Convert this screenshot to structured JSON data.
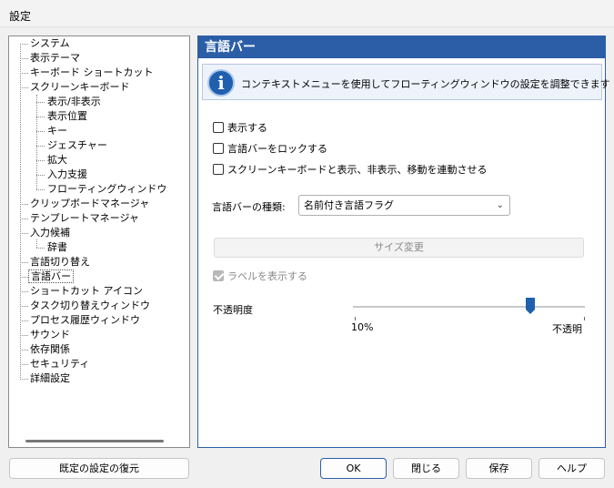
{
  "window": {
    "title": "設定"
  },
  "tree": {
    "items": [
      {
        "label": "システム"
      },
      {
        "label": "表示テーマ"
      },
      {
        "label": "キーボード ショートカット"
      },
      {
        "label": "スクリーンキーボード"
      },
      {
        "label": "表示/非表示"
      },
      {
        "label": "表示位置"
      },
      {
        "label": "キー"
      },
      {
        "label": "ジェスチャー"
      },
      {
        "label": "拡大"
      },
      {
        "label": "入力支援"
      },
      {
        "label": "フローティングウィンドウ"
      },
      {
        "label": "クリップボードマネージャ"
      },
      {
        "label": "テンプレートマネージャ"
      },
      {
        "label": "入力候補"
      },
      {
        "label": "辞書"
      },
      {
        "label": "言語切り替え"
      },
      {
        "label": "言語バー"
      },
      {
        "label": "ショートカット アイコン"
      },
      {
        "label": "タスク切り替えウィンドウ"
      },
      {
        "label": "プロセス履歴ウィンドウ"
      },
      {
        "label": "サウンド"
      },
      {
        "label": "依存関係"
      },
      {
        "label": "セキュリティ"
      },
      {
        "label": "詳細設定"
      }
    ],
    "selected": "言語バー"
  },
  "panel": {
    "title": "言語バー",
    "info_text": "コンテキストメニューを使用してフローティングウィンドウの設定を調整できます",
    "options": {
      "show": {
        "label": "表示する",
        "checked": false
      },
      "lock": {
        "label": "言語バーをロックする",
        "checked": false
      },
      "sync": {
        "label": "スクリーンキーボードと表示、非表示、移動を連動させる",
        "checked": false
      }
    },
    "type_label": "言語バーの種類:",
    "type_value": "名前付き言語フラグ",
    "resize_button": "サイズ変更",
    "show_labels": {
      "label": "ラベルを表示する",
      "checked": true,
      "enabled": false
    },
    "opacity": {
      "label": "不透明度",
      "min_label": "10%",
      "max_label": "不透明",
      "value_fraction": 0.76
    }
  },
  "buttons": {
    "restore": "既定の設定の復元",
    "ok": "OK",
    "close": "閉じる",
    "save": "保存",
    "help": "ヘルプ"
  },
  "colors": {
    "accent": "#2c5ea8",
    "info_bg": "#eef3fb",
    "slider_thumb": "#1f5fae"
  }
}
